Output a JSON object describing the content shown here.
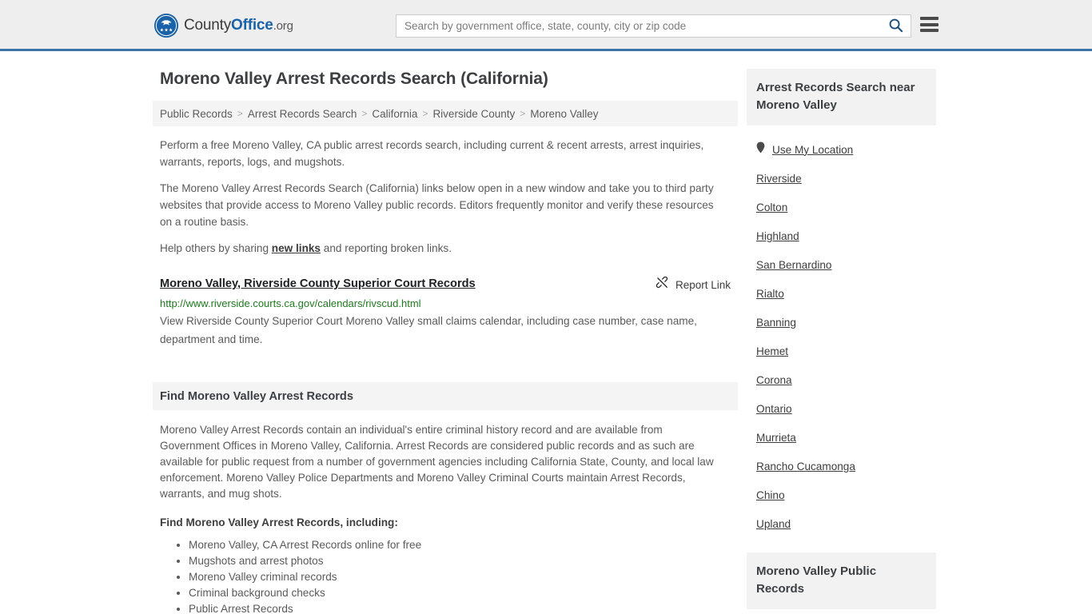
{
  "header": {
    "brand": {
      "part1": "County",
      "part2": "Office",
      "part3": ".org",
      "logo_icon": "eagle-shield-logo"
    },
    "search": {
      "placeholder": "Search by government office, state, county, city or zip code",
      "value": "",
      "search_icon": "search-icon"
    },
    "menu_icon": "hamburger-menu-icon",
    "accent_color": "#3b72a4"
  },
  "page": {
    "title": "Moreno Valley Arrest Records Search (California)",
    "breadcrumb": [
      "Public Records",
      "Arrest Records Search",
      "California",
      "Riverside County",
      "Moreno Valley"
    ],
    "breadcrumb_separator": ">",
    "intro_paragraph_1": "Perform a free Moreno Valley, CA public arrest records search, including current & recent arrests, arrest inquiries, warrants, reports, logs, and mugshots.",
    "intro_paragraph_2": "The Moreno Valley Arrest Records Search (California) links below open in a new window and take you to third party websites that provide access to Moreno Valley public records. Editors frequently monitor and verify these resources on a routine basis.",
    "help_prefix": "Help others by sharing ",
    "help_link": "new links",
    "help_suffix": " and reporting broken links."
  },
  "result": {
    "title": "Moreno Valley, Riverside County Superior Court Records",
    "report_label": "Report Link",
    "report_icon": "broken-link-icon",
    "url": "http://www.riverside.courts.ca.gov/calendars/rivscud.html",
    "description": "View Riverside County Superior Court Moreno Valley small claims calendar, including case number, case name, department and time.",
    "url_color": "#1f7a1f"
  },
  "section": {
    "heading": "Find Moreno Valley Arrest Records",
    "paragraph": "Moreno Valley Arrest Records contain an individual's entire criminal history record and are available from Government Offices in Moreno Valley, California. Arrest Records are considered public records and as such are available for public request from a number of government agencies including California State, County, and local law enforcement. Moreno Valley Police Departments and Moreno Valley Criminal Courts maintain Arrest Records, warrants, and mug shots.",
    "list_intro": "Find Moreno Valley Arrest Records, including:",
    "bullets": [
      "Moreno Valley, CA Arrest Records online for free",
      "Mugshots and arrest photos",
      "Moreno Valley criminal records",
      "Criminal background checks",
      "Public Arrest Records"
    ]
  },
  "sidebar": {
    "nearby_heading": "Arrest Records Search near Moreno Valley",
    "use_my_location": {
      "label": "Use My Location",
      "icon": "map-pin-icon"
    },
    "cities": [
      "Riverside",
      "Colton",
      "Highland",
      "San Bernardino",
      "Rialto",
      "Banning",
      "Hemet",
      "Corona",
      "Ontario",
      "Murrieta",
      "Rancho Cucamonga",
      "Chino",
      "Upland"
    ],
    "public_records_heading": "Moreno Valley Public Records"
  }
}
